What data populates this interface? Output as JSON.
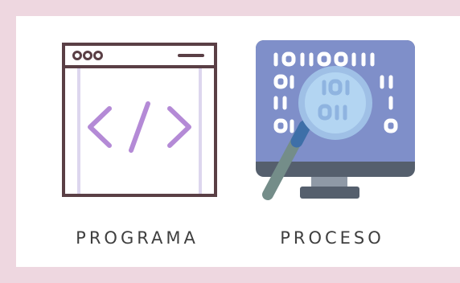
{
  "items": [
    {
      "label": "PROGRAMA",
      "icon": "code-window-icon"
    },
    {
      "label": "PROCESO",
      "icon": "binary-monitor-magnifier-icon"
    }
  ],
  "colors": {
    "background": "#eed7e0",
    "card": "#ffffff",
    "window_frame": "#5a3f45",
    "code_brackets": "#b48ad6",
    "monitor_screen": "#7f8fc9",
    "monitor_body": "#555f6d",
    "magnifier_lens": "#a9cdf0",
    "magnifier_handle": "#748d89",
    "label_text": "#3f3f3f"
  },
  "binary_rows": [
    "1011001",
    "01",
    "11",
    "01"
  ]
}
